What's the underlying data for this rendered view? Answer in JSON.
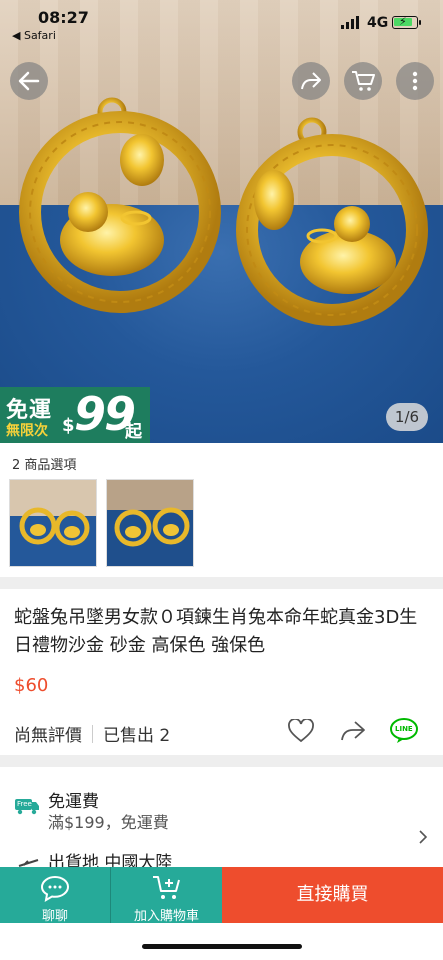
{
  "status": {
    "time": "08:27",
    "back_app": "◀ Safari",
    "network": "4G"
  },
  "nav": {
    "back_icon": "arrow-left-icon",
    "share_icon": "share-icon",
    "cart_icon": "cart-icon",
    "more_icon": "more-vertical-icon"
  },
  "promo": {
    "line1": "免運",
    "line2": "無限次",
    "dollar": "$",
    "amount": "99",
    "suffix": "起"
  },
  "gallery": {
    "pager": "1/6"
  },
  "options": {
    "label": "2 商品選項"
  },
  "product": {
    "title": "蛇盤兔吊墜男女款０項鍊生肖兔本命年蛇真金3D生日禮物沙金 砂金 高保色 強保色",
    "price": "$60",
    "rating": "尚無評價",
    "sold": "已售出 2"
  },
  "shipping": {
    "title": "免運費",
    "subtitle": "滿$199，免運費",
    "origin": "出貨地 中國大陸",
    "free_badge": "Free",
    "line_badge": "LINE"
  },
  "bottom": {
    "chat": "聊聊",
    "add_cart": "加入購物車",
    "buy_now": "直接購買"
  },
  "colors": {
    "primary": "#26aa99",
    "accent": "#ee4d2d",
    "promo_bg": "#1e7d5e"
  }
}
